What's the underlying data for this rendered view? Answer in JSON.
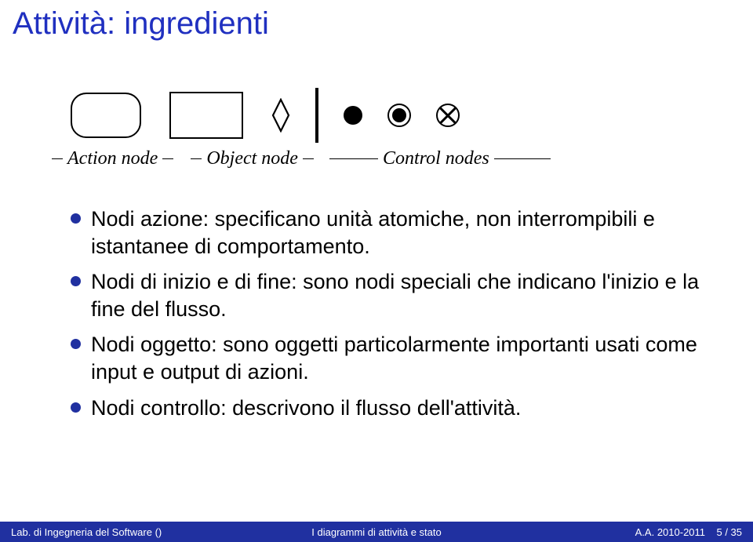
{
  "title": "Attività: ingredienti",
  "labels": {
    "action": "Action node",
    "object": "Object node",
    "control": "Control nodes"
  },
  "bullets": [
    "Nodi azione: specificano unità atomiche, non interrompibili e istantanee di comportamento.",
    "Nodi di inizio e di fine: sono nodi speciali che indicano l'inizio e la fine del flusso.",
    "Nodi oggetto: sono oggetti particolarmente importanti usati come input e output di azioni.",
    "Nodi controllo: descrivono il flusso dell'attività."
  ],
  "footer": {
    "left": "Lab. di Ingegneria del Software ()",
    "center": "I diagrammi di attività e stato",
    "right_year": "A.A. 2010-2011",
    "right_page": "5 / 35"
  }
}
